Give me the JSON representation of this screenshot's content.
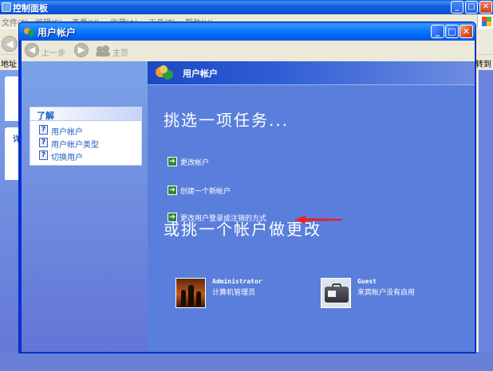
{
  "background_window": {
    "title": "控制面板",
    "menu": [
      "文件(F)",
      "编辑(E)",
      "查看(V)",
      "收藏(A)",
      "工具(T)",
      "帮助(H)"
    ],
    "address_label": "地址",
    "goto_label": "转到",
    "side_panel_title": "详"
  },
  "window": {
    "title": "用户帐户",
    "controls": {
      "minimize": "_",
      "maximize": "□",
      "close": "✕"
    }
  },
  "toolbar": {
    "back_label": "上一步",
    "home_label": "主页"
  },
  "learn": {
    "title": "了解",
    "items": [
      {
        "label": "用户帐户"
      },
      {
        "label": "用户帐户类型"
      },
      {
        "label": "切换用户"
      }
    ]
  },
  "main": {
    "header_title": "用户帐户",
    "pick_task": "挑选一项任务...",
    "tasks": [
      {
        "label": "更改帐户"
      },
      {
        "label": "创建一个新帐户"
      },
      {
        "label": "更改用户登录或注销的方式"
      }
    ],
    "pick_account": "或挑一个帐户做更改",
    "accounts": [
      {
        "name": "Administrator",
        "desc": "计算机管理员"
      },
      {
        "name": "Guest",
        "desc": "来宾帐户没有启用"
      }
    ]
  },
  "colors": {
    "xp_blue": "#0831d9",
    "main_bg": "#5a7edc",
    "link_blue": "#215dc6",
    "annotation_red": "#e8202a"
  }
}
